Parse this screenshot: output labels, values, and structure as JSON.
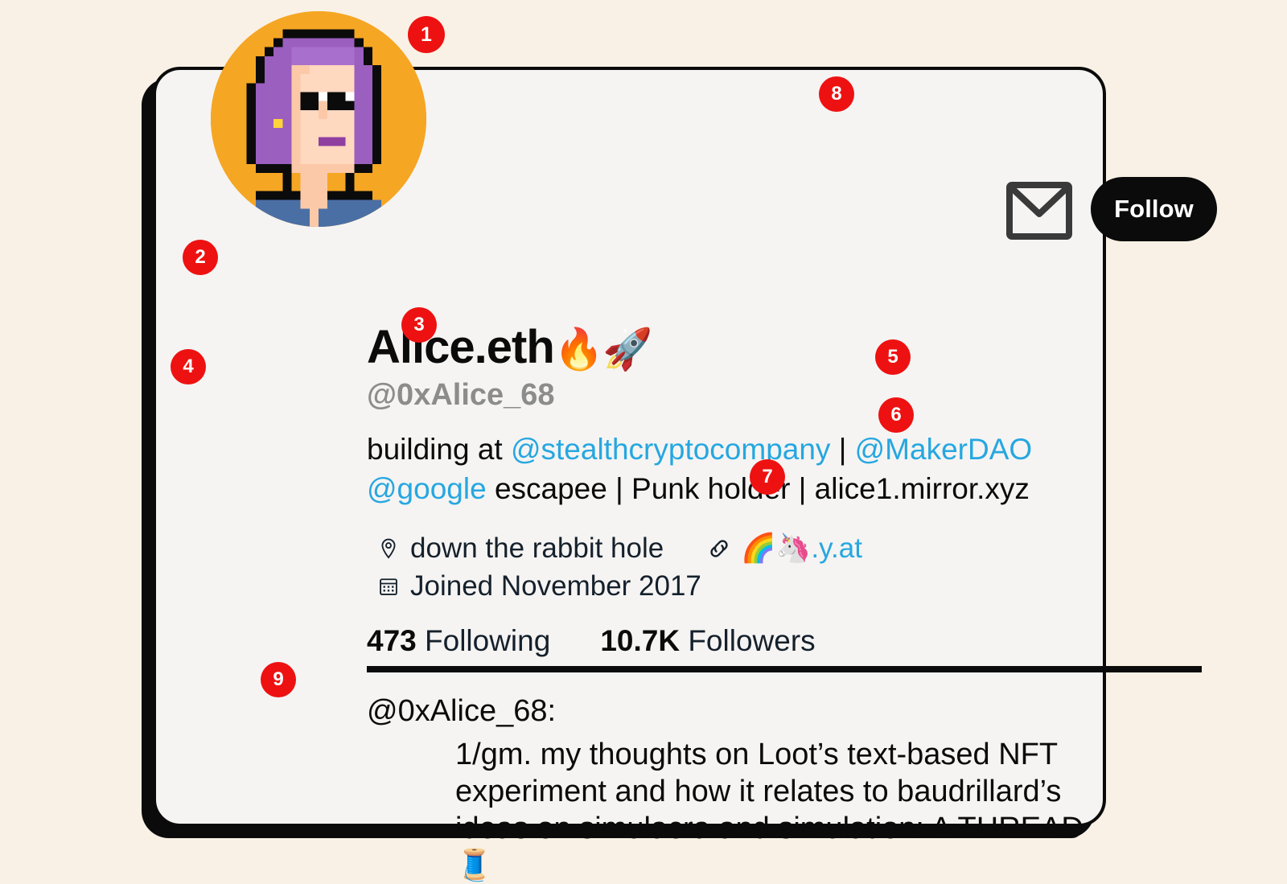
{
  "page": {
    "background_color": "#F9F1E5",
    "card_background": "#F5F4F3",
    "accent_red": "#EE1111",
    "link_blue": "#26A7E0",
    "avatar_bg": "#F5A623"
  },
  "profile": {
    "avatar_alt": "cryptopunk-pixel-avatar",
    "display_name": "Alice.eth",
    "display_name_emoji": "🔥🚀",
    "handle": "@0xAlice_68",
    "bio": {
      "segment_1": "building at ",
      "mention_1": "@stealthcryptocompany",
      "separator_1": " | ",
      "mention_2": "@MakerDAO",
      "mention_3": "@google",
      "segment_2": " escapee | Punk holder | alice1.mirror.xyz"
    },
    "location": "down the rabbit hole",
    "website": "🌈🦄.y.at",
    "joined": "Joined November 2017",
    "following_count": "473",
    "following_label": "Following",
    "followers_count": "10.7K",
    "followers_label": "Followers"
  },
  "actions": {
    "message_icon": "envelope-icon",
    "follow_label": "Follow"
  },
  "tweet": {
    "author_handle": "@0xAlice_68:",
    "text": "1/gm. my thoughts on Loot’s text-based NFT experiment and how it relates to baudrillard’s ideas on simulacra and simulation: A THREAD 🧵"
  },
  "annotations": {
    "b1": "1",
    "b2": "2",
    "b3": "3",
    "b4": "4",
    "b5": "5",
    "b6": "6",
    "b7": "7",
    "b8": "8",
    "b9": "9"
  }
}
